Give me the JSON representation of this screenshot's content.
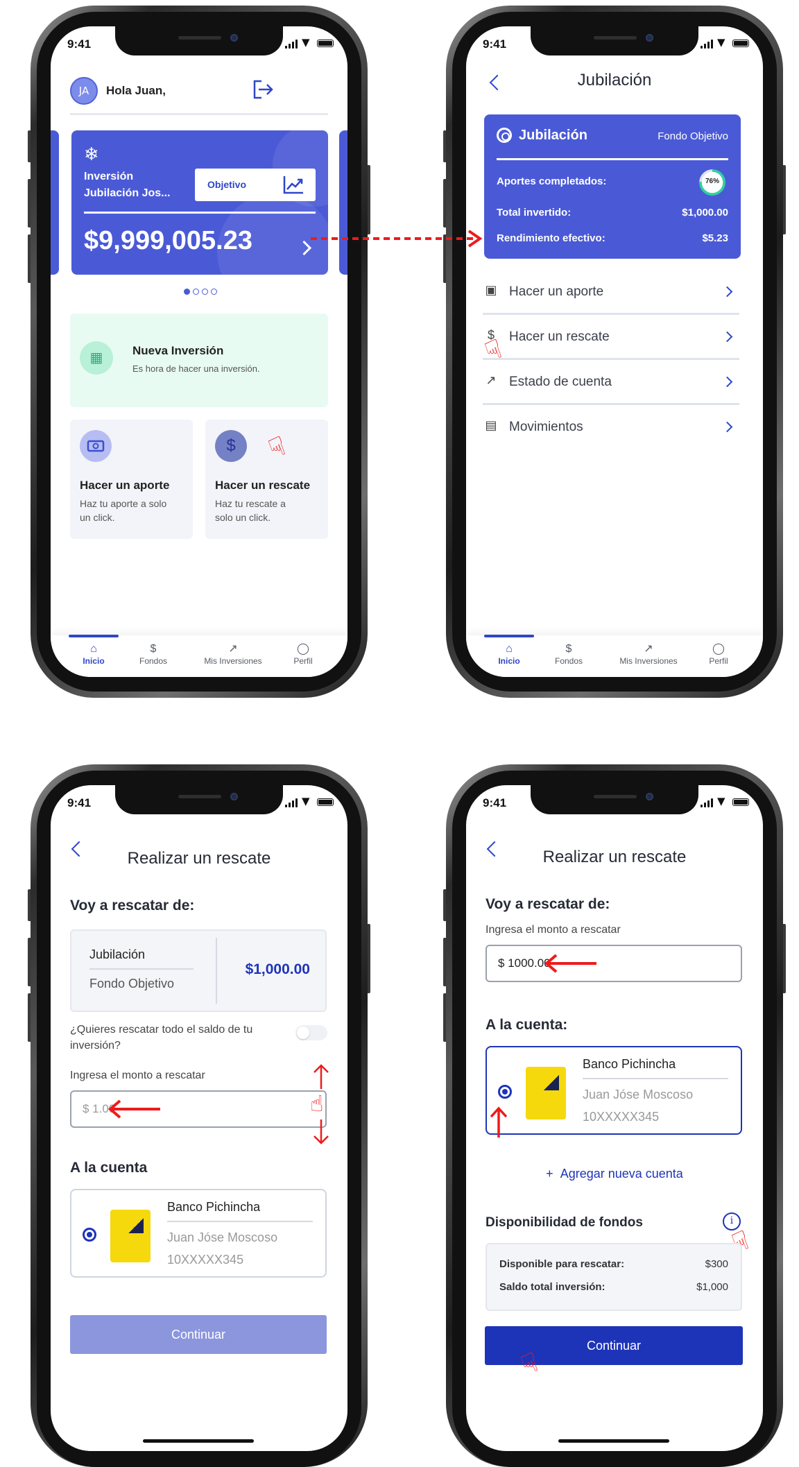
{
  "status": {
    "time": "9:41"
  },
  "screen1": {
    "avatar_initials": "JA",
    "greeting": "Hola Juan,",
    "card": {
      "name_line1": "Inversión",
      "name_line2": "Jubilación Jos...",
      "pill_label": "Objetivo",
      "amount": "$9,999,005.23"
    },
    "promo": {
      "title": "Nueva Inversión",
      "subtitle": "Es hora de hacer una inversión."
    },
    "tile_aporte": {
      "title": "Hacer un aporte",
      "desc_line1": "Haz tu aporte a solo",
      "desc_line2": "un click."
    },
    "tile_rescate": {
      "title": "Hacer un rescate",
      "desc_line1": "Haz tu rescate a",
      "desc_line2": "solo un click."
    }
  },
  "tabs": [
    {
      "label": "Inicio",
      "icon": "home-icon"
    },
    {
      "label": "Fondos",
      "icon": "dollar-icon"
    },
    {
      "label": "Mis Inversiones",
      "icon": "chart-icon"
    },
    {
      "label": "Perfil",
      "icon": "user-icon"
    }
  ],
  "screen2": {
    "header_title": "Jubilación",
    "card": {
      "title": "Jubilación",
      "type": "Fondo Objetivo",
      "aportes_label": "Aportes completados:",
      "aportes_progress_pct": 76,
      "aportes_progress_text": "76%",
      "total_label": "Total invertido:",
      "total_value": "$1,000.00",
      "rend_label": "Rendimiento efectivo:",
      "rend_value": "$5.23"
    },
    "menu": [
      "Hacer un aporte",
      "Hacer un rescate",
      "Estado de cuenta",
      "Movimientos"
    ]
  },
  "screen3": {
    "header_title": "Realizar un rescate",
    "section_from": "Voy a rescatar de:",
    "fund_name": "Jubilación",
    "fund_type": "Fondo Objetivo",
    "fund_amount": "$1,000.00",
    "toggle_question_line1": "¿Quieres rescatar todo el saldo de tu",
    "toggle_question_line2": "inversión?",
    "amount_label": "Ingresa el monto a rescatar",
    "amount_value": "$ 1.00",
    "section_account": "A la cuenta",
    "bank_name": "Banco Pichincha",
    "holder": "Juan Jóse Moscoso",
    "account_number": "10XXXXX345",
    "continue_label": "Continuar"
  },
  "screen4": {
    "header_title": "Realizar un rescate",
    "section_from": "Voy a rescatar de:",
    "amount_label": "Ingresa el monto a rescatar",
    "amount_value": "$ 1000.00",
    "section_account": "A la cuenta:",
    "bank_name": "Banco Pichincha",
    "holder": "Juan Jóse Moscoso",
    "account_number": "10XXXXX345",
    "add_account": "Agregar nueva cuenta",
    "availability_title": "Disponibilidad de fondos",
    "available_label": "Disponible para rescatar:",
    "available_value": "$300",
    "total_label": "Saldo total inversión:",
    "total_value": "$1,000",
    "continue_label": "Continuar"
  },
  "colors": {
    "primary": "#4a5ad6",
    "primary_dark": "#1e34b8",
    "disabled": "#8b96dd",
    "annotation_red": "#ee1b1b",
    "promo_bg": "#e8fbf3"
  }
}
